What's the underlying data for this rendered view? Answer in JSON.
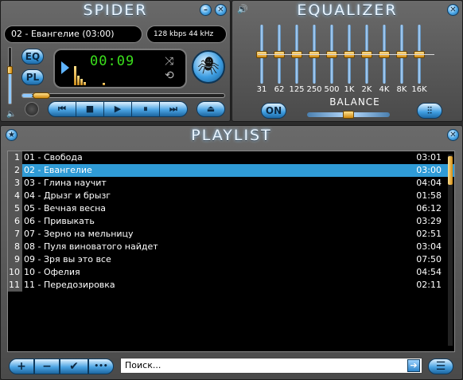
{
  "player": {
    "title": "SPIDER",
    "minimize_label": "–",
    "close_label": "✕",
    "track_title": "02 - Евангелие (03:00)",
    "bitrate": "128 kbps 44 kHz",
    "time": "00:09",
    "eq_label": "EQ",
    "pl_label": "PL",
    "controls": {
      "prev": "⏮",
      "stop": "■",
      "play": "▶",
      "pause": "⏸",
      "next": "⏭",
      "eject": "⏏"
    }
  },
  "equalizer": {
    "title": "EQUALIZER",
    "close_label": "✕",
    "bands": [
      {
        "label": "31",
        "level": 0.5
      },
      {
        "label": "62",
        "level": 0.5
      },
      {
        "label": "125",
        "level": 0.5
      },
      {
        "label": "250",
        "level": 0.5
      },
      {
        "label": "500",
        "level": 0.5
      },
      {
        "label": "1K",
        "level": 0.5
      },
      {
        "label": "2K",
        "level": 0.5
      },
      {
        "label": "4K",
        "level": 0.5
      },
      {
        "label": "8K",
        "level": 0.5
      },
      {
        "label": "16K",
        "level": 0.5
      }
    ],
    "on_label": "ON",
    "balance_label": "BALANCE",
    "balance_value": 0.5
  },
  "playlist": {
    "title": "PLAYLIST",
    "close_label": "✕",
    "selected_index": 1,
    "items": [
      {
        "num": "1",
        "name": "01 - Свобода",
        "duration": "03:01"
      },
      {
        "num": "2",
        "name": "02 - Евангелие",
        "duration": "03:00"
      },
      {
        "num": "3",
        "name": "03 - Глина научит",
        "duration": "04:04"
      },
      {
        "num": "4",
        "name": "04 - Дрызг и брызг",
        "duration": "01:58"
      },
      {
        "num": "5",
        "name": "05 - Вечная весна",
        "duration": "06:12"
      },
      {
        "num": "6",
        "name": "06 - Привыкать",
        "duration": "03:29"
      },
      {
        "num": "7",
        "name": "07 - Зерно на мельницу",
        "duration": "02:51"
      },
      {
        "num": "8",
        "name": "08 - Пуля виноватого найдет",
        "duration": "03:04"
      },
      {
        "num": "9",
        "name": "09 - Зря вы это все",
        "duration": "07:50"
      },
      {
        "num": "10",
        "name": "10 - Офелия",
        "duration": "04:54"
      },
      {
        "num": "11",
        "name": "11 - Передозировка",
        "duration": "02:11"
      }
    ],
    "add_label": "+",
    "remove_label": "−",
    "check_label": "✔",
    "more_label": "•••",
    "search_placeholder": "Поиск...",
    "search_go": "➔",
    "menu_label": "☰"
  },
  "state": {
    "volume": 0.6,
    "seek": 0.05,
    "playlist_scroll": 0.0
  },
  "colors": {
    "accent": "#2f9bd6",
    "time": "#3be01c"
  }
}
